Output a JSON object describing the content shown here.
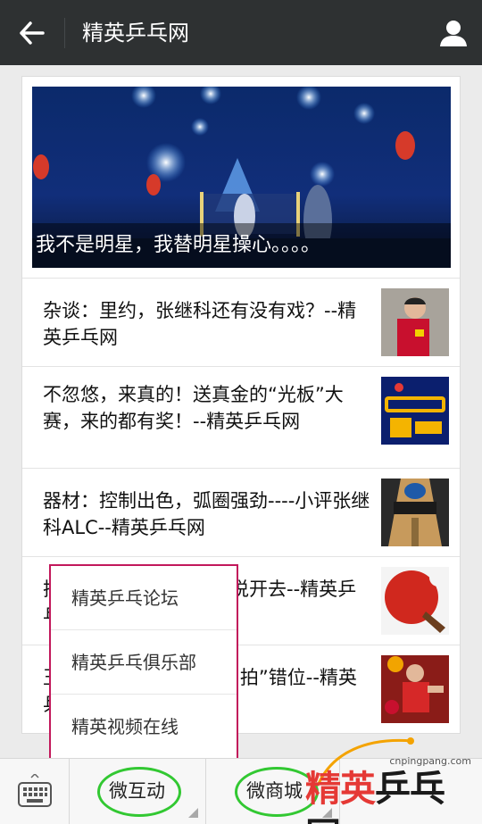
{
  "header": {
    "title": "精英乒乓网"
  },
  "hero": {
    "caption": "我不是明星，我替明星操心。。。。"
  },
  "articles": [
    {
      "title": "杂谈：里约，张继科还有没有戏？--精英乒乓网"
    },
    {
      "title": "不忽悠，来真的！送真金的“光板”大赛，来的都有奖！--精英乒乓网"
    },
    {
      "title": "器材：控制出色，弧圈强劲----小评张继科ALC--精英乒乓网"
    },
    {
      "title": "把乒乓这个运动的现象说开去--精英乒乓网"
    },
    {
      "title": "王皓这么多年让球友“引拍”错位--精英乒乓网"
    }
  ],
  "popup": {
    "items": [
      "精英乒乓论坛",
      "精英乒乓俱乐部",
      "精英视频在线"
    ]
  },
  "bottom_bar": {
    "tabs": [
      "微互动",
      "微商城"
    ],
    "highlight_color": "#32c832"
  },
  "watermark": {
    "url": "cnpingpang.com",
    "text_first": "精英",
    "text_rest": "乒乓网"
  },
  "colors": {
    "header_bg": "#2e3132",
    "popup_border": "#c2185b"
  }
}
